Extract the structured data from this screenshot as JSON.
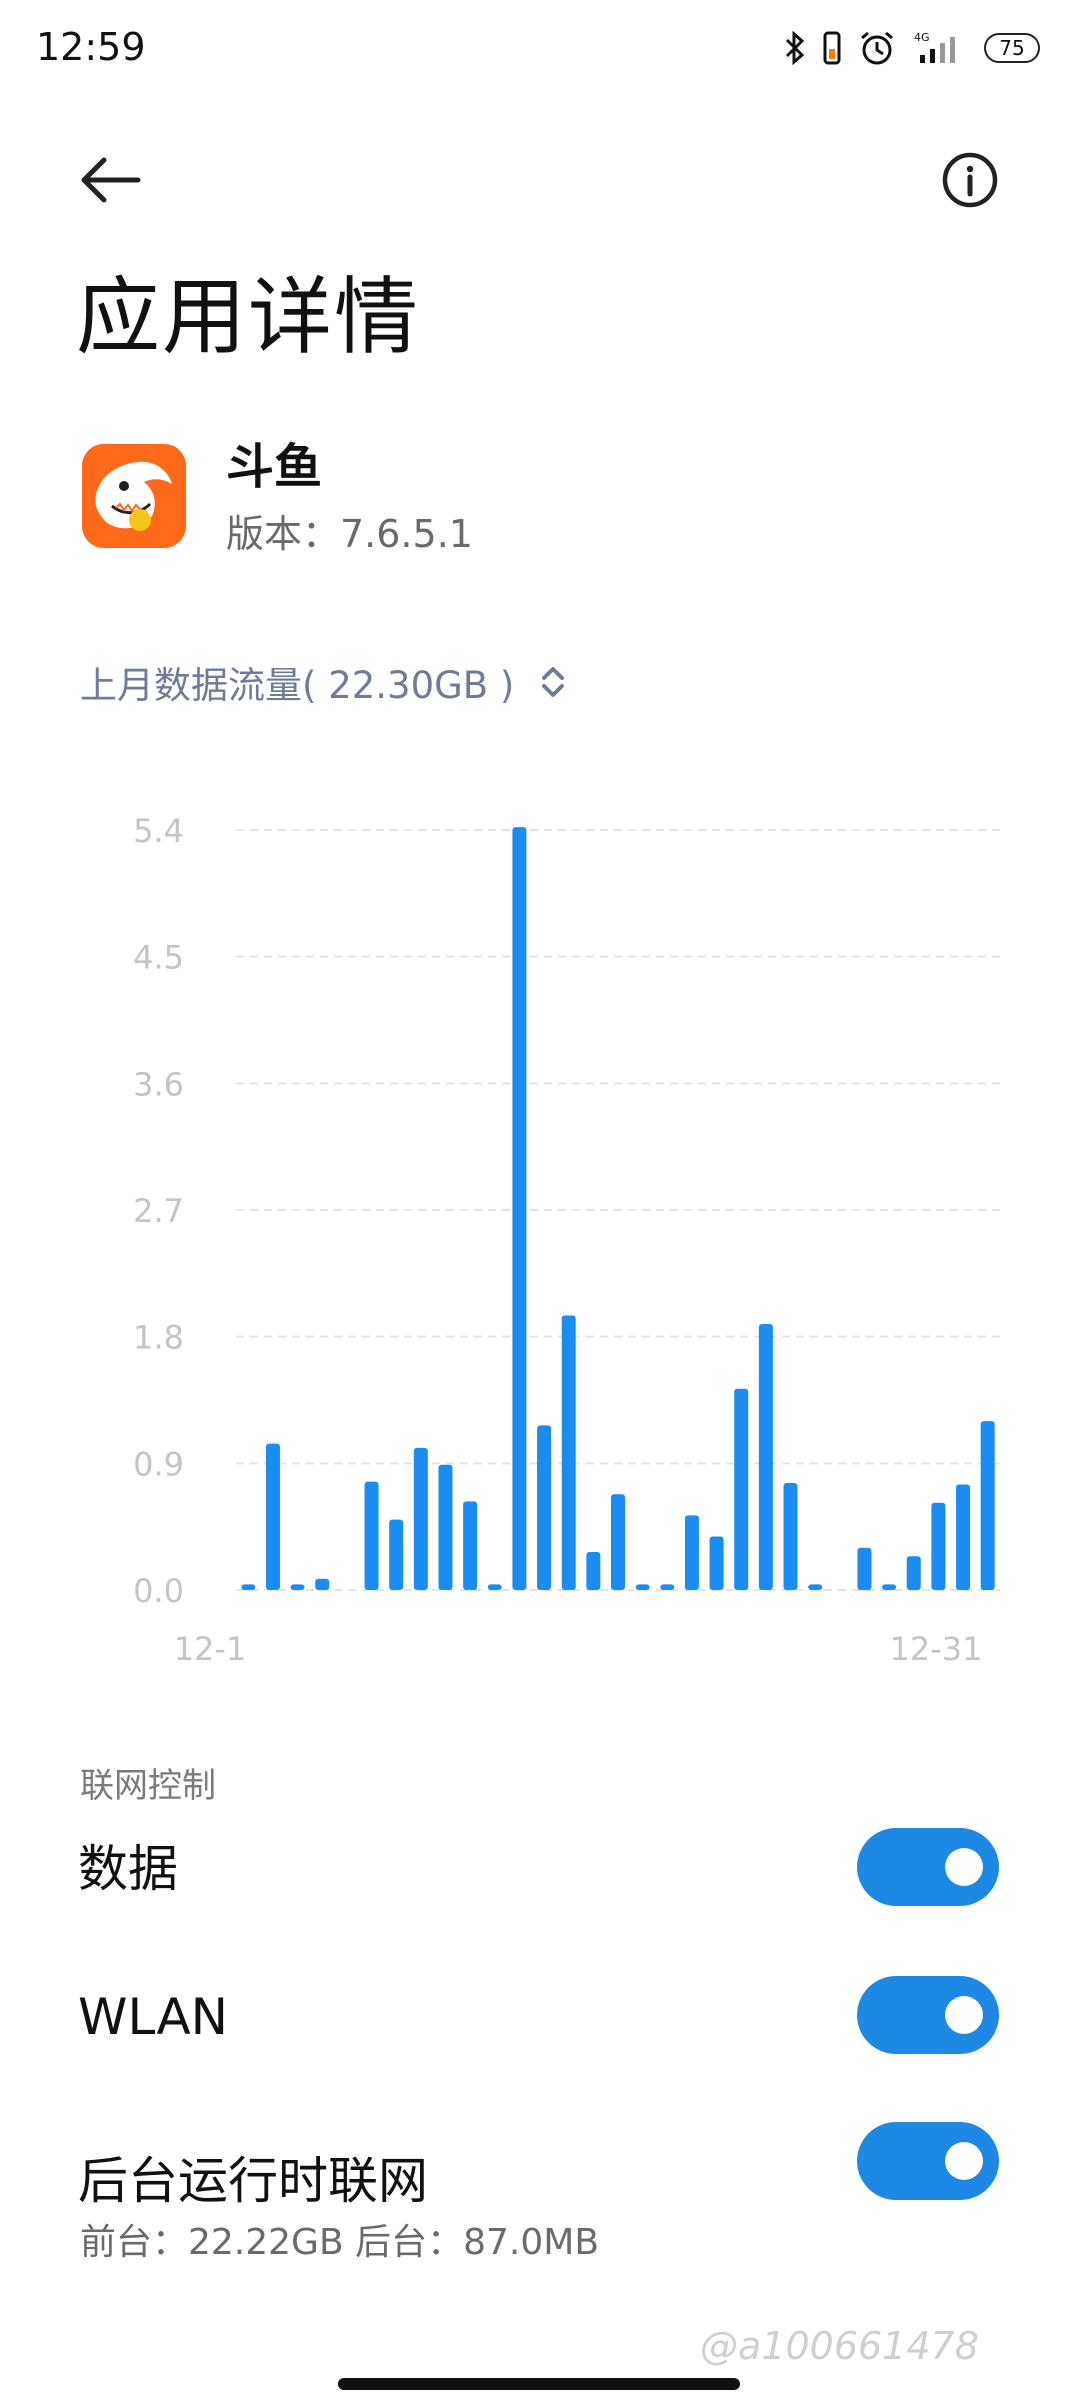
{
  "status_bar": {
    "time": "12:59",
    "network": "4G",
    "battery": "75",
    "icons": [
      "bluetooth-icon",
      "vibrate-icon",
      "alarm-icon",
      "signal-icon",
      "battery-icon"
    ]
  },
  "header": {
    "title": "应用详情",
    "back_icon": "back-arrow-icon",
    "info_icon": "info-icon"
  },
  "app": {
    "name": "斗鱼",
    "version": "版本：7.6.5.1",
    "icon_color": "#ff6a1a"
  },
  "usage": {
    "label": "上月数据流量( 22.30GB )",
    "icon": "expand-icon"
  },
  "chart_data": {
    "type": "bar",
    "x": [
      1,
      2,
      3,
      4,
      5,
      6,
      7,
      8,
      9,
      10,
      11,
      12,
      13,
      14,
      15,
      16,
      17,
      18,
      19,
      20,
      21,
      22,
      23,
      24,
      25,
      26,
      27,
      28,
      29,
      30,
      31
    ],
    "values": [
      0.04,
      1.04,
      0.04,
      0.08,
      0.0,
      0.77,
      0.5,
      1.01,
      0.89,
      0.63,
      0.04,
      5.42,
      1.17,
      1.95,
      0.27,
      0.68,
      0.04,
      0.04,
      0.53,
      0.38,
      1.43,
      1.89,
      0.76,
      0.04,
      0.0,
      0.3,
      0.04,
      0.24,
      0.62,
      0.75,
      1.2
    ],
    "yticks": [
      "5.4",
      "4.5",
      "3.6",
      "2.7",
      "1.8",
      "0.9",
      "0.0"
    ],
    "ylim": [
      0,
      5.4
    ],
    "xlabels": {
      "start": "12-1",
      "end": "12-31"
    },
    "grid": true,
    "bar_color": "#1a8cf2"
  },
  "network_control": {
    "section_label": "联网控制",
    "rows": [
      {
        "label": "数据",
        "enabled": true
      },
      {
        "label": "WLAN",
        "enabled": true
      },
      {
        "label": "后台运行时联网",
        "sub": "前台：22.22GB  后台：87.0MB",
        "enabled": true
      }
    ]
  },
  "watermark": "@a100661478",
  "accent": "#1e88e5"
}
